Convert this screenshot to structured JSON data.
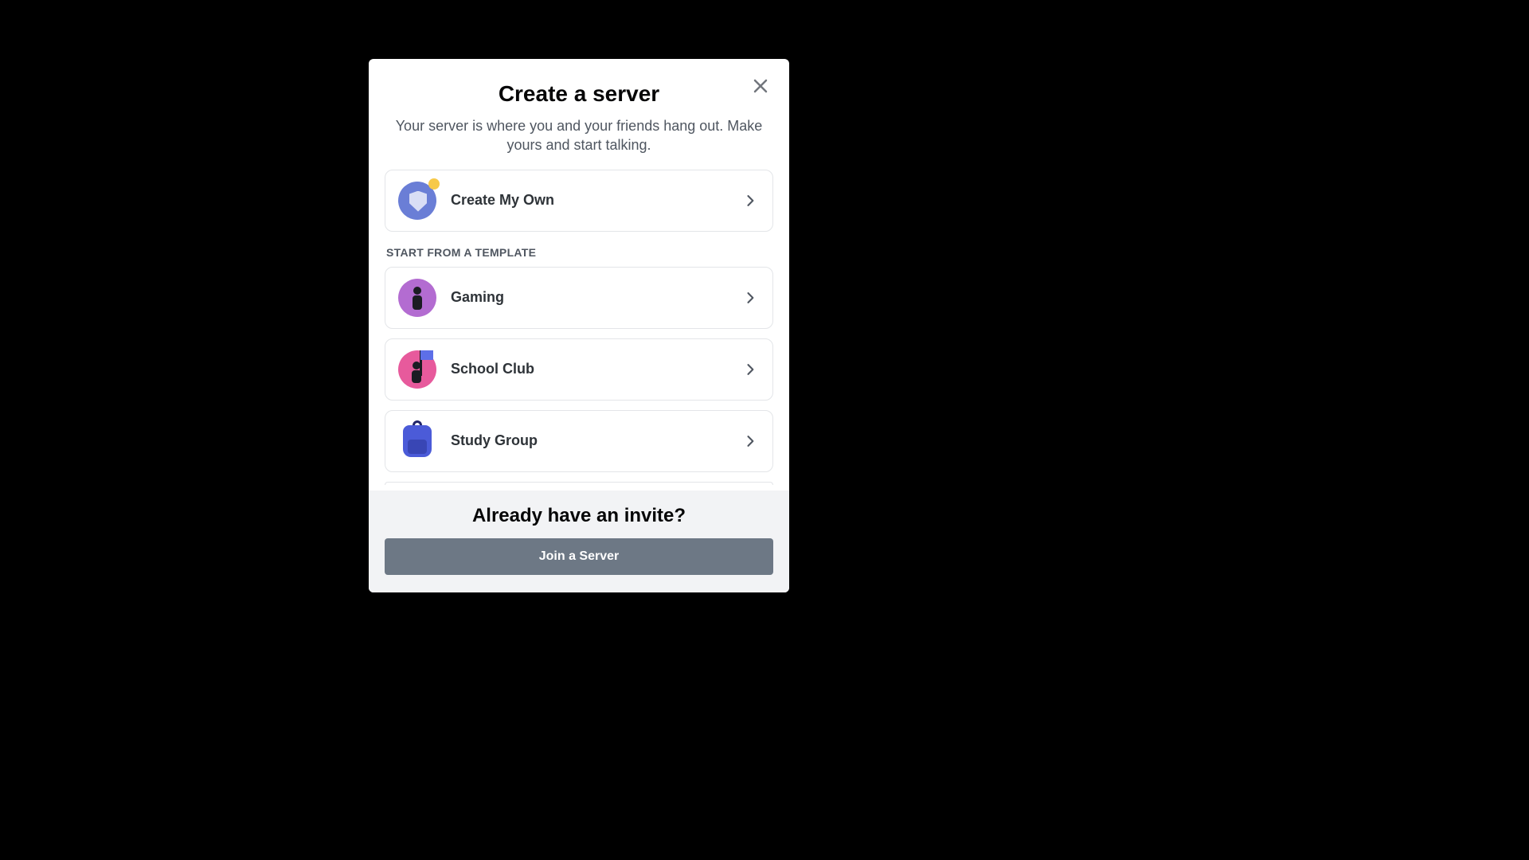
{
  "modal": {
    "title": "Create a server",
    "subtitle": "Your server is where you and your friends hang out. Make yours and start talking.",
    "create_own": {
      "label": "Create My Own"
    },
    "template_section_label": "START FROM A TEMPLATE",
    "templates": [
      {
        "label": "Gaming"
      },
      {
        "label": "School Club"
      },
      {
        "label": "Study Group"
      }
    ],
    "footer": {
      "heading": "Already have an invite?",
      "join_label": "Join a Server"
    }
  }
}
